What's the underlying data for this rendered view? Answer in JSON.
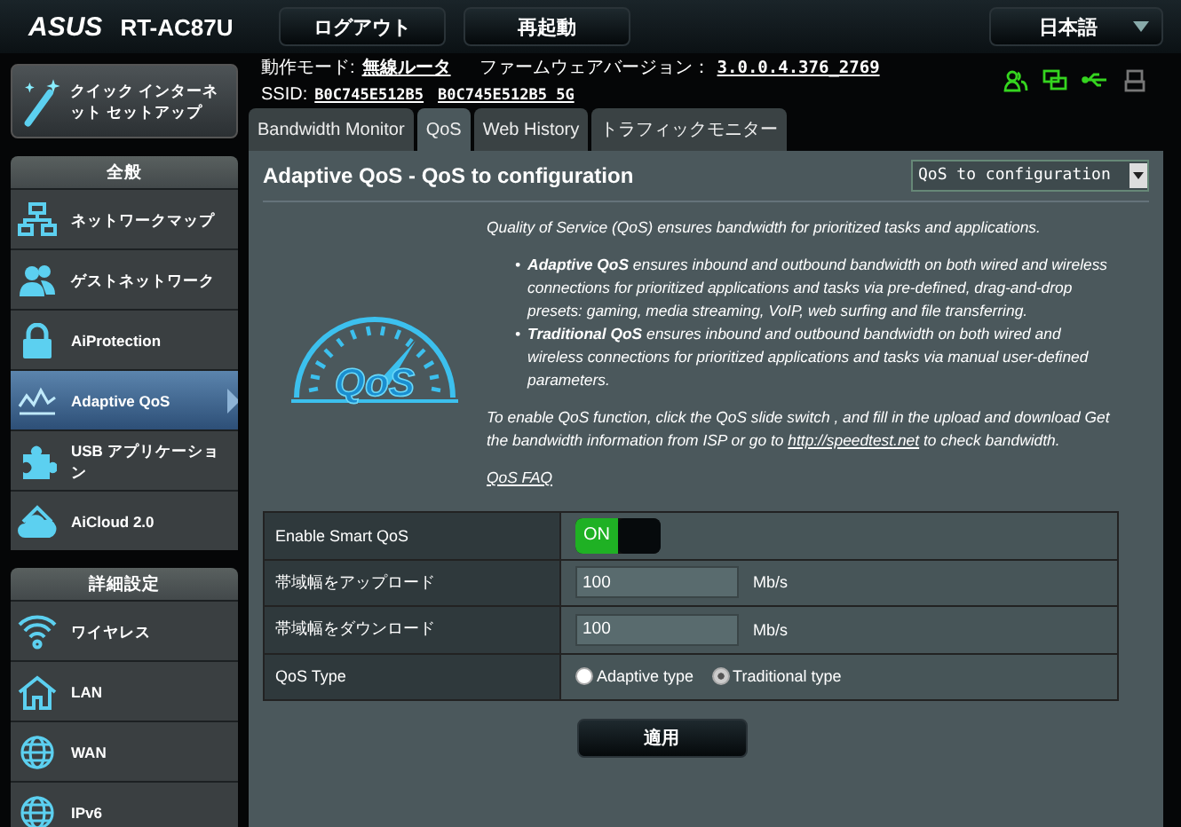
{
  "brand": {
    "logo": "ASUS",
    "model": "RT-AC87U"
  },
  "top_buttons": [
    "ログアウト",
    "再起動"
  ],
  "language": "日本語",
  "info": {
    "mode_label": "動作モード:",
    "mode_value": "無線ルータ",
    "firmware_label": "ファームウェアバージョン：",
    "firmware_value": "3.0.0.4.376_2769",
    "ssid_label": "SSID:",
    "ssids": [
      "B0C745E512B5",
      "B0C745E512B5_5G"
    ]
  },
  "quick_setup": "クイック インターネット セットアップ",
  "sidebar": [
    {
      "heading": "全般",
      "items": [
        {
          "kind": "network",
          "label": "ネットワークマップ",
          "selected": false
        },
        {
          "kind": "guest",
          "label": "ゲストネットワーク",
          "selected": false
        },
        {
          "kind": "lock",
          "label": "AiProtection",
          "selected": false
        },
        {
          "kind": "chart",
          "label": "Adaptive QoS",
          "selected": true
        },
        {
          "kind": "puzzle",
          "label": "USB アプリケーション",
          "selected": false
        },
        {
          "kind": "cloud",
          "label": "AiCloud 2.0",
          "selected": false
        }
      ]
    },
    {
      "heading": "詳細設定",
      "items": [
        {
          "kind": "wifi",
          "label": "ワイヤレス",
          "selected": false
        },
        {
          "kind": "house",
          "label": "LAN",
          "selected": false
        },
        {
          "kind": "globe",
          "label": "WAN",
          "selected": false
        },
        {
          "kind": "globe",
          "label": "IPv6",
          "selected": false
        }
      ]
    }
  ],
  "tabs": [
    {
      "label": "Bandwidth Monitor",
      "selected": false
    },
    {
      "label": "QoS",
      "selected": true
    },
    {
      "label": "Web History",
      "selected": false
    },
    {
      "label": "トラフィックモニター",
      "selected": false
    }
  ],
  "panel": {
    "title": "Adaptive QoS - QoS to configuration",
    "mode_select": "QoS to configuration",
    "logo_text": "QoS",
    "intro": "Quality of Service (QoS) ensures bandwidth for prioritized tasks and applications.",
    "bullet_marker": "•",
    "bullets": [
      "**Adaptive QoS** ensures inbound and outbound bandwidth on both wired and wireless connections for prioritized applications and tasks via pre-defined, drag-and-drop presets: gaming, media streaming, VoIP, web surfing and file transferring.",
      "**Traditional QoS** ensures inbound and outbound bandwidth on both wired and wireless connections for prioritized applications and tasks via manual user-defined parameters."
    ],
    "instructions": {
      "before": "To enable QoS function, click the QoS slide switch , and fill in the upload and download Get the bandwidth information from ISP or go to",
      "link": "http://speedtest.net",
      "after": "to check bandwidth."
    },
    "faq_link": "QoS FAQ"
  },
  "settings": [
    {
      "kind": "switch",
      "label": "Enable Smart QoS",
      "on": true,
      "switch_text": "ON"
    },
    {
      "kind": "number",
      "label": "帯域幅をアップロード",
      "value": "100",
      "unit": "Mb/s"
    },
    {
      "kind": "number",
      "label": "帯域幅をダウンロード",
      "value": "100",
      "unit": "Mb/s"
    },
    {
      "kind": "radio",
      "label": "QoS Type",
      "options": [
        {
          "label": "Adaptive type",
          "selected": false
        },
        {
          "label": "Traditional type",
          "selected": true
        }
      ]
    }
  ],
  "apply_button": "適用"
}
